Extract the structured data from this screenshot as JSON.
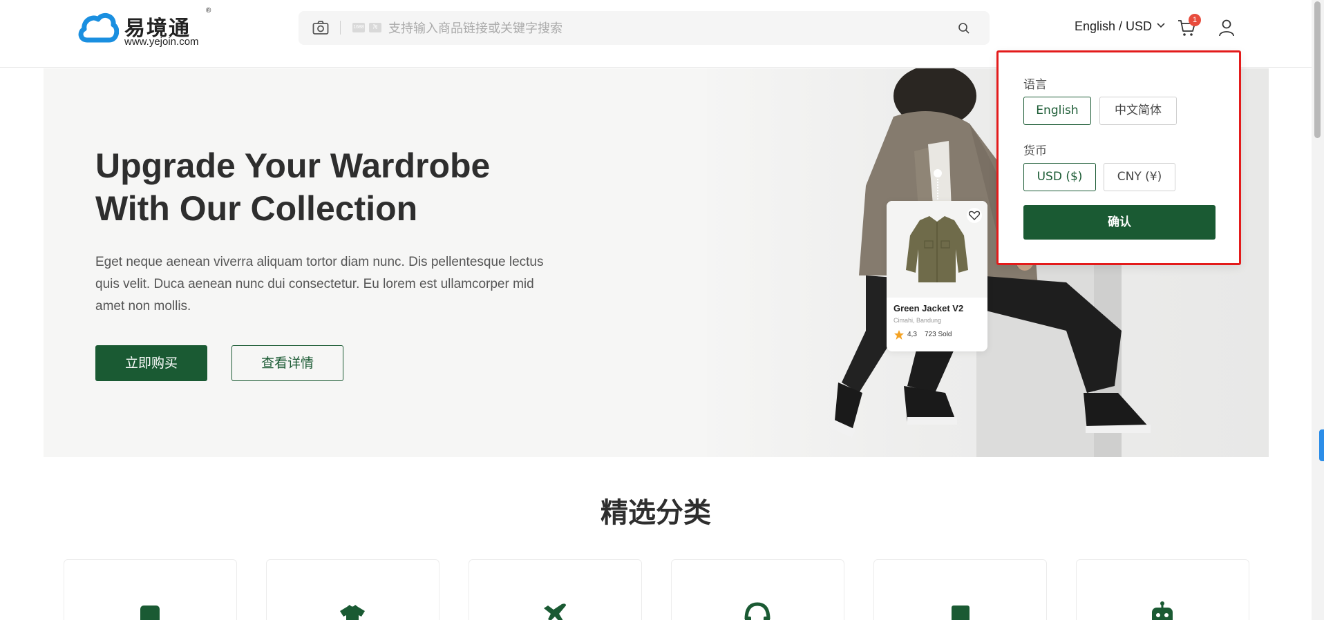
{
  "header": {
    "logo": {
      "name": "易境通",
      "url": "www.yejoin.com",
      "reg_mark": "®"
    },
    "search": {
      "placeholder": "支持输入商品链接或关键字搜索",
      "camera_icon": "camera-icon",
      "search_icon": "search-icon"
    },
    "locale_switch": {
      "label": "English / USD"
    },
    "cart": {
      "count": "1",
      "icon": "cart-icon"
    },
    "user_icon": "user-icon"
  },
  "hero": {
    "title_line1": "Upgrade Your Wardrobe",
    "title_line2": "With Our Collection",
    "description": "Eget neque aenean viverra aliquam tortor diam nunc. Dis pellentesque lectus quis velit. Duca aenean nunc dui consectetur. Eu lorem est ullamcorper mid amet non mollis.",
    "buy_button": "立即购买",
    "detail_button": "查看详情",
    "product_card": {
      "name": "Green Jacket V2",
      "location": "Cimahi, Bandung",
      "rating": "4,3",
      "sold": "723 Sold"
    }
  },
  "locale_dropdown": {
    "language_label": "语言",
    "languages": [
      {
        "label": "English",
        "selected": true
      },
      {
        "label": "中文简体",
        "selected": false
      }
    ],
    "currency_label": "货币",
    "currencies": [
      {
        "label": "USD ($)",
        "selected": true
      },
      {
        "label": "CNY (¥)",
        "selected": false
      }
    ],
    "confirm_button": "确认"
  },
  "categories": {
    "title": "精选分类",
    "items": [
      {
        "icon": "phone-icon"
      },
      {
        "icon": "tshirt-icon"
      },
      {
        "icon": "airplane-icon"
      },
      {
        "icon": "headphones-icon"
      },
      {
        "icon": "book-icon"
      },
      {
        "icon": "robot-icon"
      }
    ]
  },
  "colors": {
    "primary": "#1a5a33",
    "highlight_border": "#e31b1b",
    "badge": "#e84c3d",
    "hero_bg": "#f6f6f5"
  }
}
